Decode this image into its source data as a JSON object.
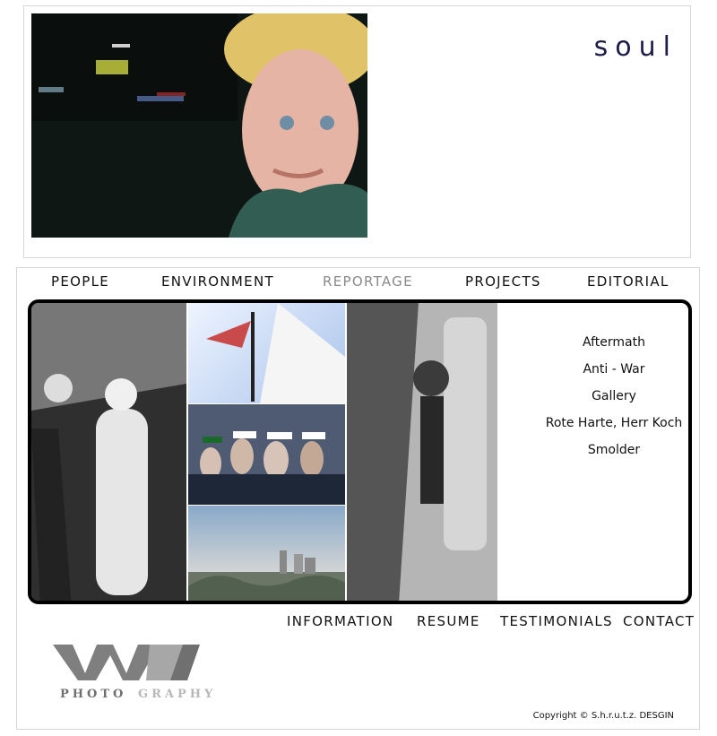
{
  "header": {
    "title": "soul"
  },
  "main_nav": [
    {
      "label": "PEOPLE",
      "active": false
    },
    {
      "label": "ENVIRONMENT",
      "active": false
    },
    {
      "label": "REPORTAGE",
      "active": true
    },
    {
      "label": "PROJECTS",
      "active": false
    },
    {
      "label": "EDITORIAL",
      "active": false
    }
  ],
  "gallery_menu": [
    "Aftermath",
    "Anti - War",
    "Gallery",
    "Rote Harte, Herr Koch",
    "Smolder"
  ],
  "footer_nav": [
    "INFORMATION",
    "RESUME",
    "TESTIMONIALS",
    "CONTACT"
  ],
  "brand": {
    "logo_letters": "WN",
    "tagline_dark": "PHOTO",
    "tagline_light": "GRAPHY"
  },
  "copyright": "Copyright © S.h.r.u.t.z. DESGIN",
  "colors": {
    "title": "#1c1c4a",
    "nav_active": "#8a8a8a",
    "logo_dark": "#6f6f6f",
    "logo_light": "#b8b8b8"
  }
}
